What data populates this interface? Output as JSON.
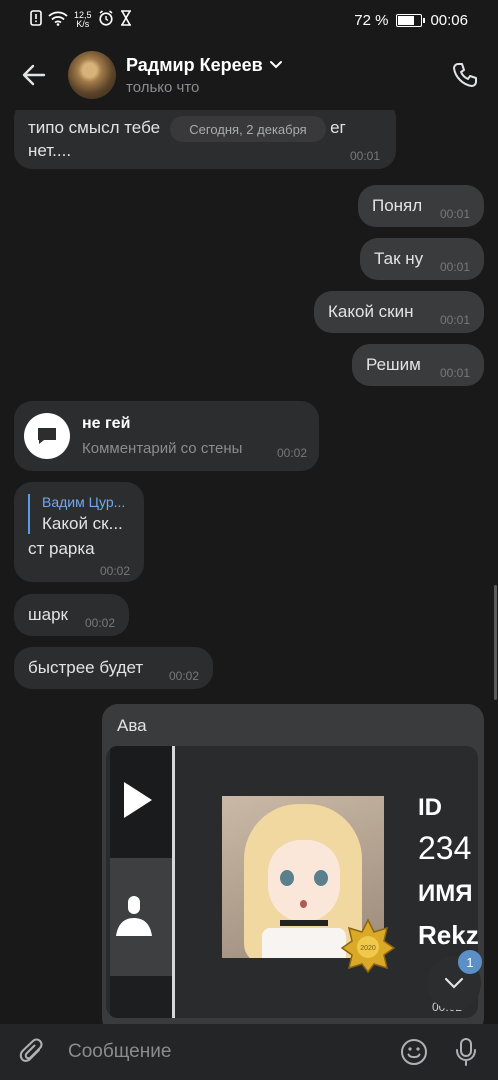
{
  "status": {
    "speed": "12,5",
    "speed_unit": "K/s",
    "battery": "72 %",
    "clock": "00:06"
  },
  "header": {
    "name": "Радмир Кереев",
    "status": "только что"
  },
  "date_pill": "Сегодня, 2 декабря",
  "messages": [
    {
      "text": "типо смысл тебе писать если денег нет....",
      "time": "00:01",
      "line1": "типо смысл тебе",
      "line1b": "ег",
      "line2": "нет...."
    },
    {
      "text": "Понял",
      "time": "00:01"
    },
    {
      "text": "Так ну",
      "time": "00:01"
    },
    {
      "text": "Какой скин",
      "time": "00:01"
    },
    {
      "text": "Решим",
      "time": "00:01"
    },
    {
      "title": "не гей",
      "subtitle": "Комментарий со стены",
      "time": "00:02"
    },
    {
      "reply_author": "Вадим Цур...",
      "reply_text": "Какой ск...",
      "text": "ст рарка",
      "time": "00:02"
    },
    {
      "text": "шарк",
      "time": "00:02"
    },
    {
      "text": "быстрее будет",
      "time": "00:02"
    },
    {
      "text": "Ава",
      "time": "00:02",
      "card": {
        "id_label": "ID",
        "id_value": "234",
        "name_label": "ИМЯ",
        "name_value": "Rekz",
        "badge_year": "2020"
      }
    }
  ],
  "unread_count": "1",
  "composer": {
    "placeholder": "Сообщение"
  }
}
